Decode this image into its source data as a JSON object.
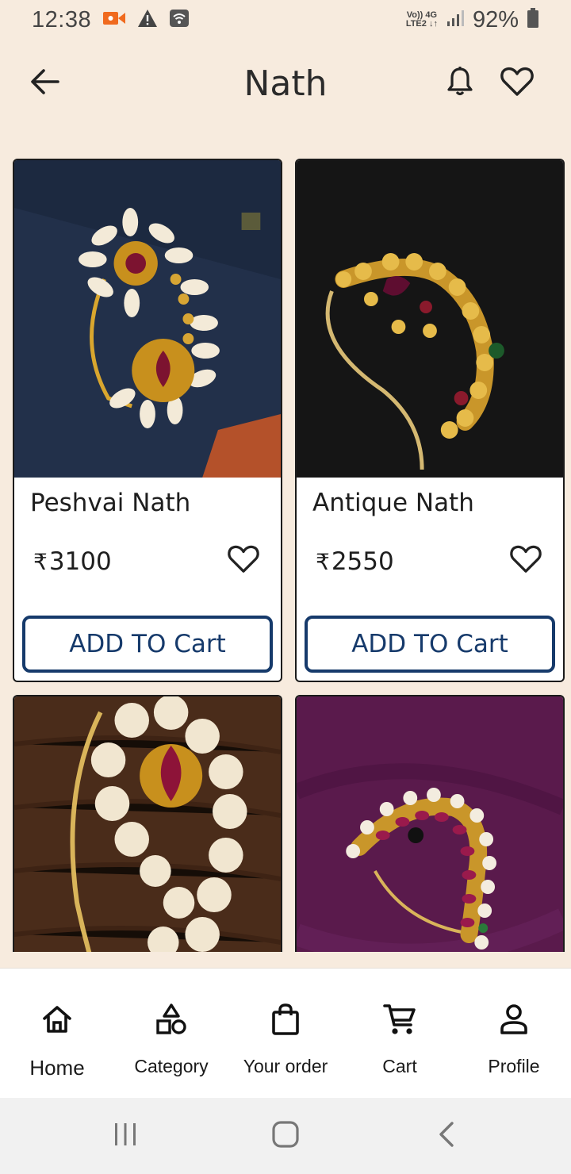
{
  "status_bar": {
    "time": "12:38",
    "network_top": "Vo)) 4G",
    "network_bottom": "LTE2 ↓↑",
    "battery": "92%"
  },
  "header": {
    "title": "Nath",
    "back_icon": "arrow-left-icon",
    "notification_icon": "bell-icon",
    "wishlist_icon": "heart-outline-icon"
  },
  "products": [
    {
      "name": "Peshvai Nath",
      "currency": "₹",
      "price": "3100",
      "button_label": "ADD TO Cart",
      "background": "#22304a"
    },
    {
      "name": "Antique Nath",
      "currency": "₹",
      "price": "2550",
      "button_label": "ADD TO Cart",
      "background": "#151515"
    },
    {
      "name": "",
      "currency": "",
      "price": "",
      "button_label": "",
      "background": "#4a2c1a"
    },
    {
      "name": "",
      "currency": "",
      "price": "",
      "button_label": "",
      "background": "#5a1a4c"
    }
  ],
  "bottom_nav": [
    {
      "label": "Home",
      "icon": "home-icon"
    },
    {
      "label": "Category",
      "icon": "shapes-icon"
    },
    {
      "label": "Your order",
      "icon": "shopping-bag-icon"
    },
    {
      "label": "Cart",
      "icon": "cart-icon"
    },
    {
      "label": "Profile",
      "icon": "user-icon"
    }
  ],
  "colors": {
    "background": "#f7ebde",
    "accent": "#163a6b",
    "card_border": "#1b1b1b"
  }
}
